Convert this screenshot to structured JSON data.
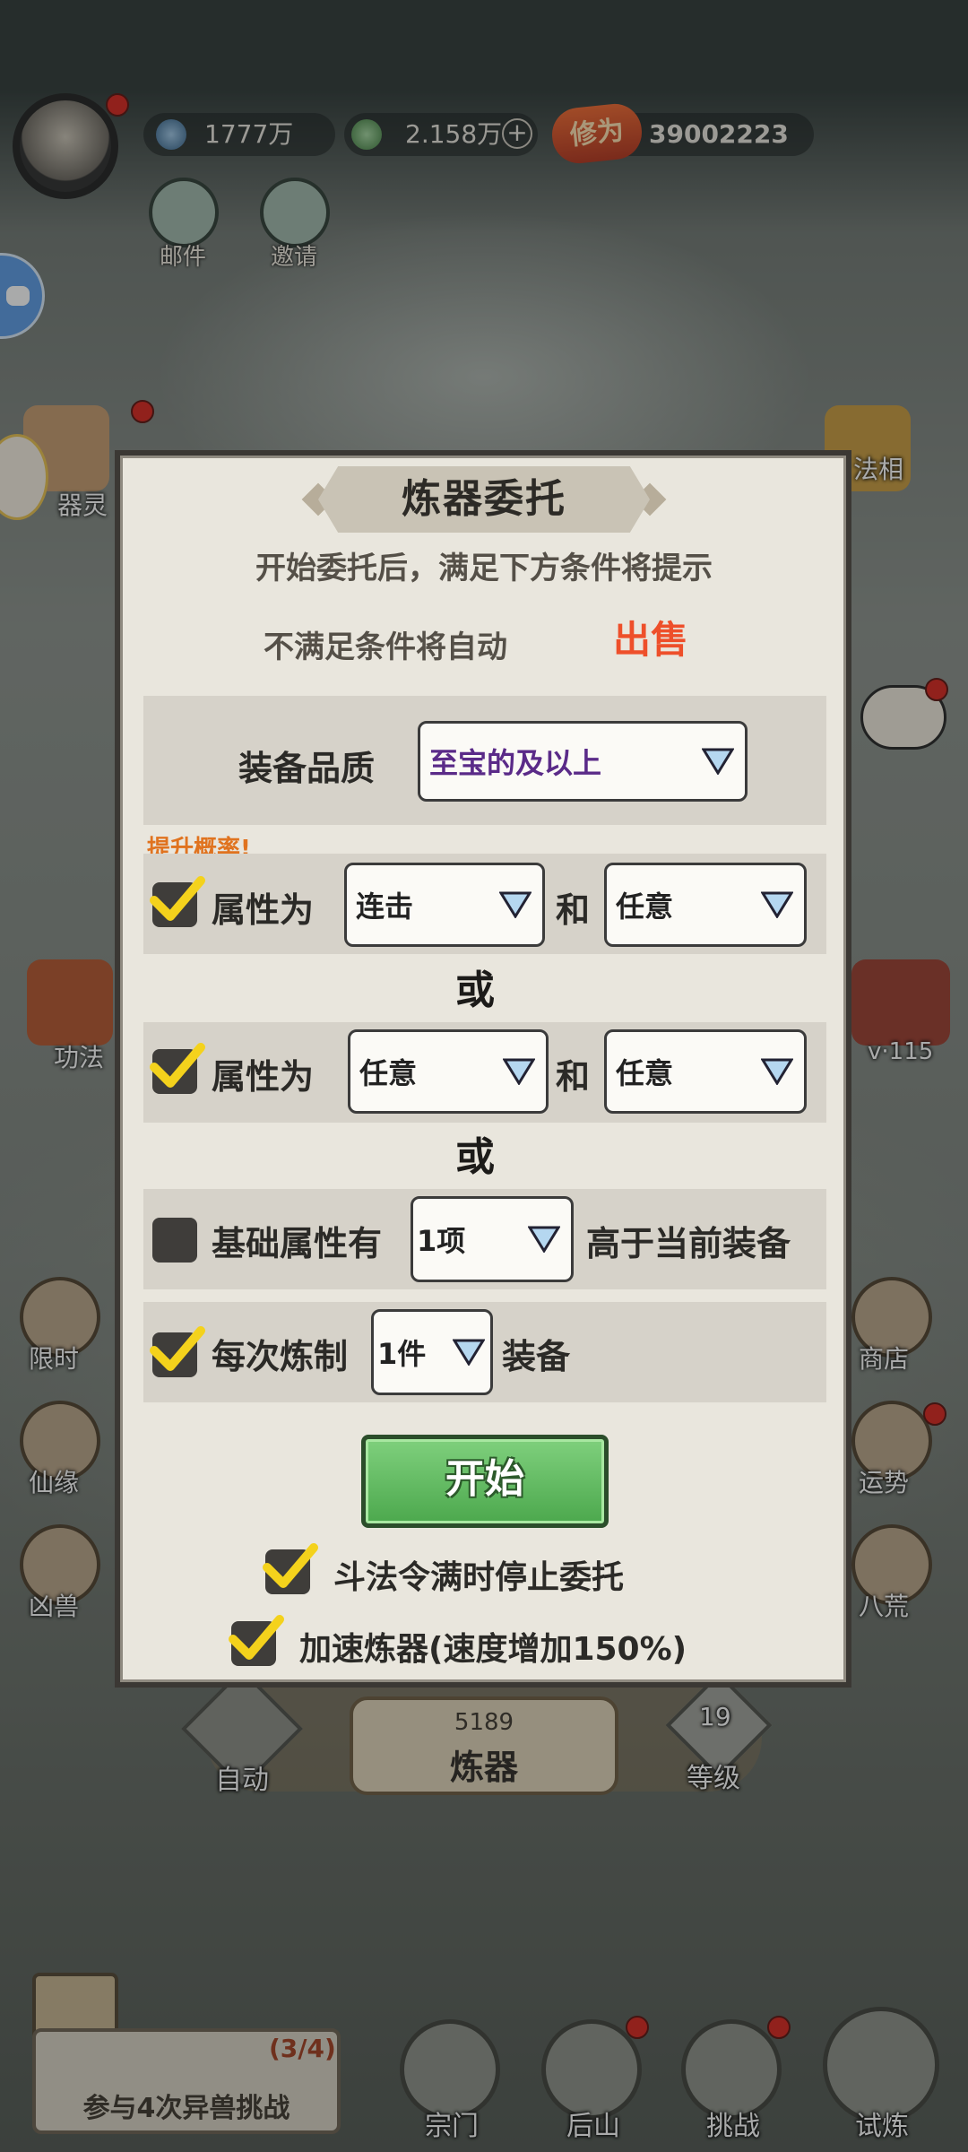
{
  "resources": {
    "spirit_stones": "1777万",
    "jade": "2.158万",
    "plus_symbol": "+",
    "cultivation_badge": "修为",
    "cultivation": "39002223"
  },
  "top_buttons": {
    "mail": "邮件",
    "invite": "邀请"
  },
  "side_left": {
    "artifact_spirit": "器灵",
    "technique": "功法",
    "limited": "限时",
    "fate": "仙缘",
    "beast": "凶兽"
  },
  "side_right": {
    "dharma": "法相",
    "level_badge": "v·115",
    "shop": "商店",
    "fortune": "运势",
    "eight_wilds": "八荒"
  },
  "dialog": {
    "title": "炼器委托",
    "line1": "开始委托后，满足下方条件将提示",
    "line2": "不满足条件将自动",
    "sell": "出售",
    "quality_label": "装备品质",
    "quality_value": "至宝的及以上",
    "boost_tip": "提升概率!",
    "rule1": {
      "label": "属性为",
      "attr1": "连击",
      "and": "和",
      "attr2": "任意",
      "checked": true
    },
    "or1": "或",
    "rule2": {
      "label": "属性为",
      "attr1": "任意",
      "and": "和",
      "attr2": "任意",
      "checked": true
    },
    "or2": "或",
    "rule3": {
      "label": "基础属性有",
      "count": "1项",
      "suffix": "高于当前装备",
      "checked": false
    },
    "rule4": {
      "label": "每次炼制",
      "count": "1件",
      "suffix": "装备",
      "checked": true
    },
    "start": "开始",
    "stop_option": "斗法令满时停止委托",
    "speed_option": "加速炼器(速度增加150%)"
  },
  "forge_bar": {
    "auto": "自动",
    "count": "5189",
    "forge": "炼器",
    "level_num": "19",
    "level": "等级"
  },
  "task": {
    "progress": "(3/4)",
    "text": "参与4次异兽挑战"
  },
  "bottom_nav": {
    "sect": "宗门",
    "back_mountain": "后山",
    "challenge": "挑战",
    "trial": "试炼"
  },
  "colors": {
    "sell": "#ee4f2a",
    "start_button": "#5fbd5e",
    "boost_tip": "#e0731f",
    "panel": "#e9e6dd",
    "notification": "#d8231b"
  }
}
